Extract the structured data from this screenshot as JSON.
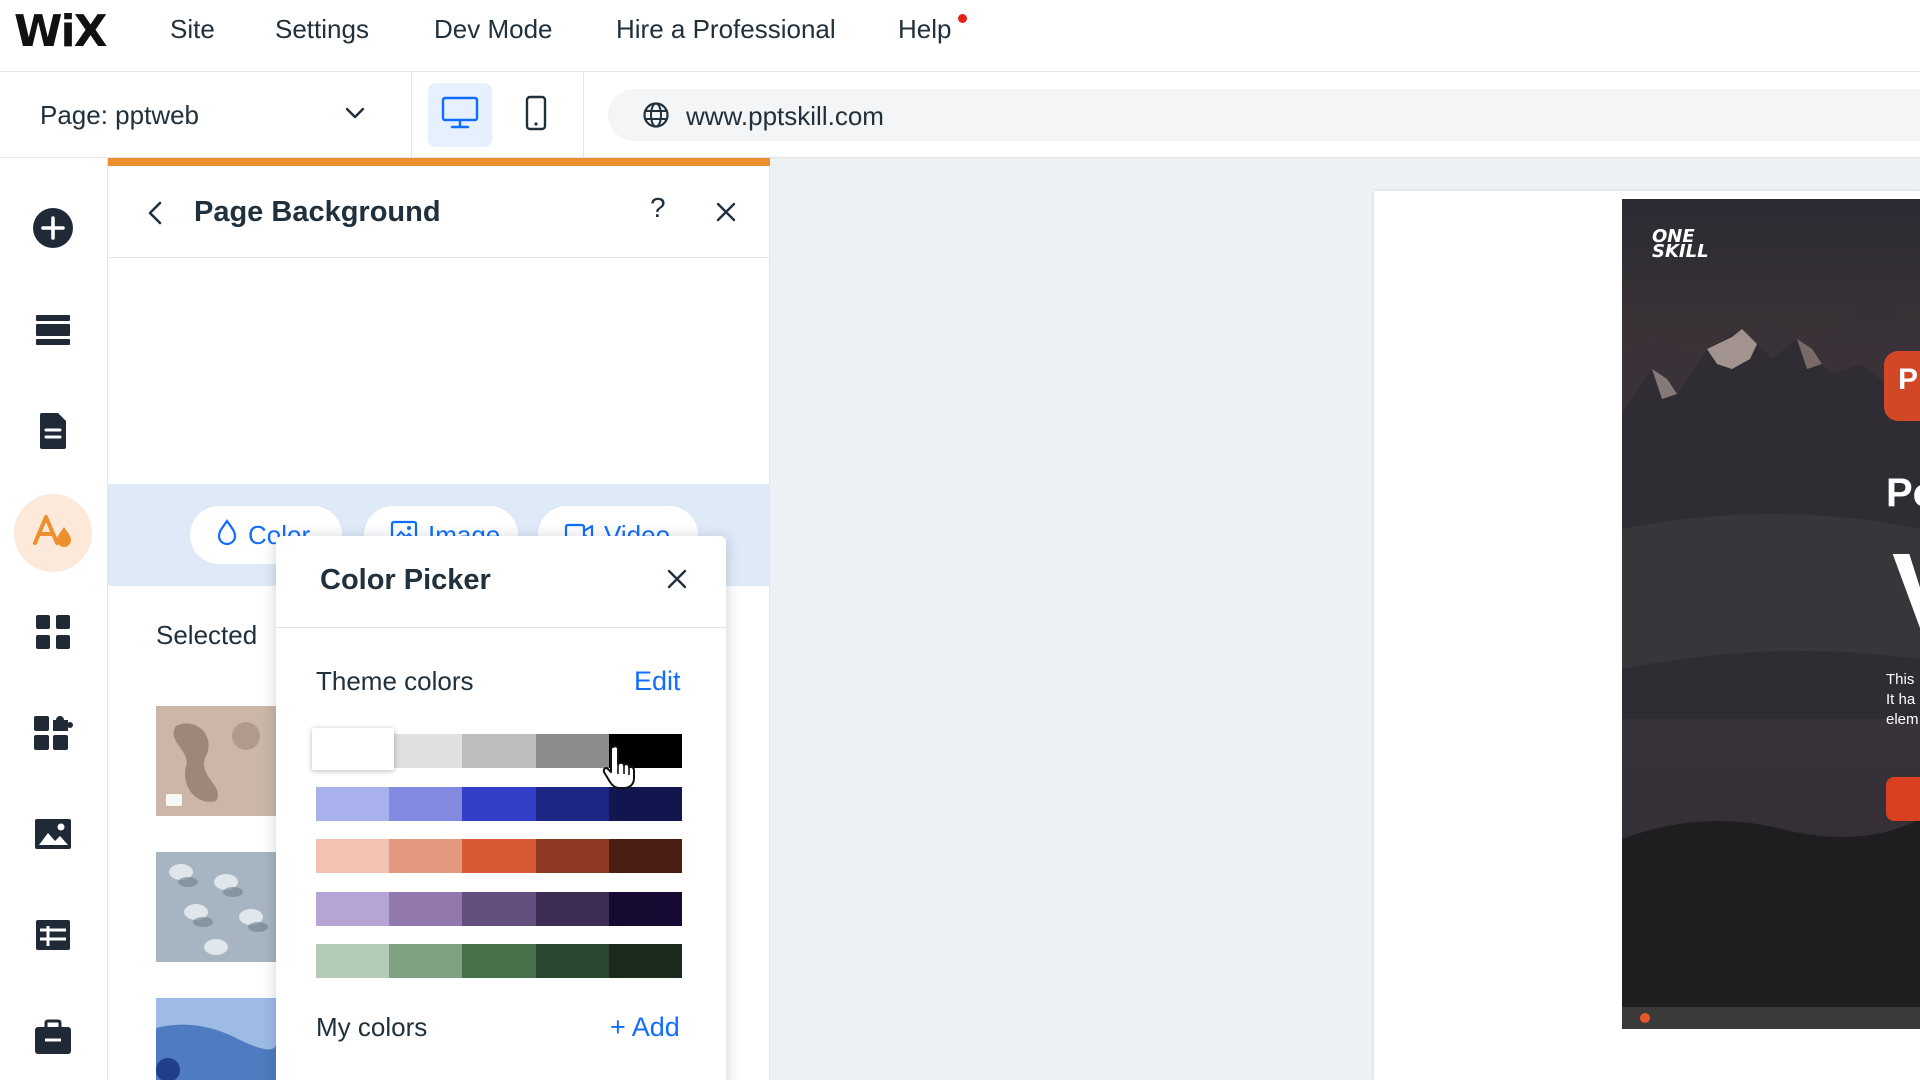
{
  "app": {
    "logo": "WiX",
    "menu": [
      {
        "label": "Site"
      },
      {
        "label": "Settings"
      },
      {
        "label": "Dev Mode"
      },
      {
        "label": "Hire a Professional"
      },
      {
        "label": "Help",
        "notification": true
      }
    ]
  },
  "toolbar": {
    "page_label": "Page: pptweb",
    "url": "www.pptskill.com",
    "device_active": "desktop"
  },
  "rail": {
    "items": [
      {
        "name": "add-elements",
        "icon": "plus-circle-icon"
      },
      {
        "name": "sections",
        "icon": "sections-icon"
      },
      {
        "name": "pages",
        "icon": "pages-icon"
      },
      {
        "name": "design",
        "icon": "theme-design-icon",
        "active": true
      },
      {
        "name": "apps",
        "icon": "apps-grid-icon"
      },
      {
        "name": "business",
        "icon": "puzzle-icon"
      },
      {
        "name": "media",
        "icon": "image-icon"
      },
      {
        "name": "cms",
        "icon": "table-icon"
      },
      {
        "name": "portfolio",
        "icon": "briefcase-icon"
      }
    ]
  },
  "panel": {
    "title": "Page Background",
    "help": "?",
    "tabs": [
      {
        "label": "Color",
        "icon": "droplet-icon"
      },
      {
        "label": "Image",
        "icon": "image-icon"
      },
      {
        "label": "Video",
        "icon": "video-icon"
      }
    ],
    "selected_label": "Selected"
  },
  "color_picker": {
    "title": "Color Picker",
    "theme_colors_label": "Theme colors",
    "edit_label": "Edit",
    "theme_rows": [
      [
        "#ffffff",
        "#e0e0e0",
        "#bdbdbd",
        "#8c8c8c",
        "#000000"
      ],
      [
        "#a9b1ec",
        "#838be0",
        "#3240c9",
        "#1d2585",
        "#12164f"
      ],
      [
        "#f2c2b2",
        "#e4987f",
        "#d65a33",
        "#8f3a22",
        "#4a1e13"
      ],
      [
        "#b6a4d4",
        "#9179ad",
        "#654f7f",
        "#3d2c53",
        "#160a33"
      ],
      [
        "#b4ccb7",
        "#7fa283",
        "#46714b",
        "#2b4730",
        "#1b2a1d"
      ]
    ],
    "my_colors_label": "My colors",
    "add_label": "+ Add"
  },
  "canvas_preview": {
    "hero_logo": "ONE SKILL",
    "badge_letter": "P",
    "heading_fragment": "Po",
    "big_letter": "V",
    "body_lines": [
      "This",
      "It ha",
      "elem"
    ]
  }
}
